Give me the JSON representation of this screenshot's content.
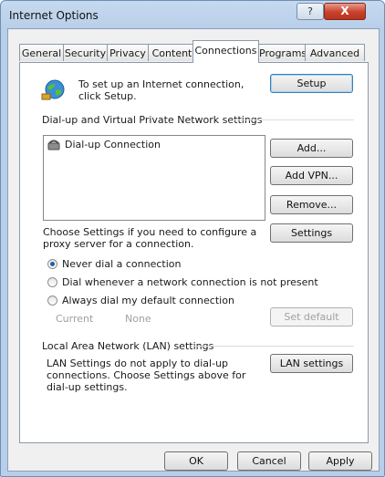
{
  "window": {
    "title": "Internet Options",
    "help": "?",
    "close": "X"
  },
  "tabs": [
    "General",
    "Security",
    "Privacy",
    "Content",
    "Connections",
    "Programs",
    "Advanced"
  ],
  "active_tab": "Connections",
  "setup": {
    "text": "To set up an Internet connection, click Setup.",
    "button": "Setup"
  },
  "dialup": {
    "group_label": "Dial-up and Virtual Private Network settings",
    "items": [
      "Dial-up Connection"
    ],
    "add": "Add...",
    "add_vpn": "Add VPN...",
    "remove": "Remove...",
    "settings_text": "Choose Settings if you need to configure a proxy server for a connection.",
    "settings": "Settings",
    "radios": [
      {
        "label": "Never dial a connection",
        "checked": true
      },
      {
        "label": "Dial whenever a network connection is not present",
        "checked": false
      },
      {
        "label": "Always dial my default connection",
        "checked": false
      }
    ],
    "current_label": "Current",
    "current_value": "None",
    "set_default": "Set default"
  },
  "lan": {
    "group_label": "Local Area Network (LAN) settings",
    "text": "LAN Settings do not apply to dial-up connections. Choose Settings above for dial-up settings.",
    "button": "LAN settings"
  },
  "footer": {
    "ok": "OK",
    "cancel": "Cancel",
    "apply": "Apply"
  },
  "icons": {
    "globe": "globe-network-icon",
    "dialup": "dialup-phone-icon"
  }
}
